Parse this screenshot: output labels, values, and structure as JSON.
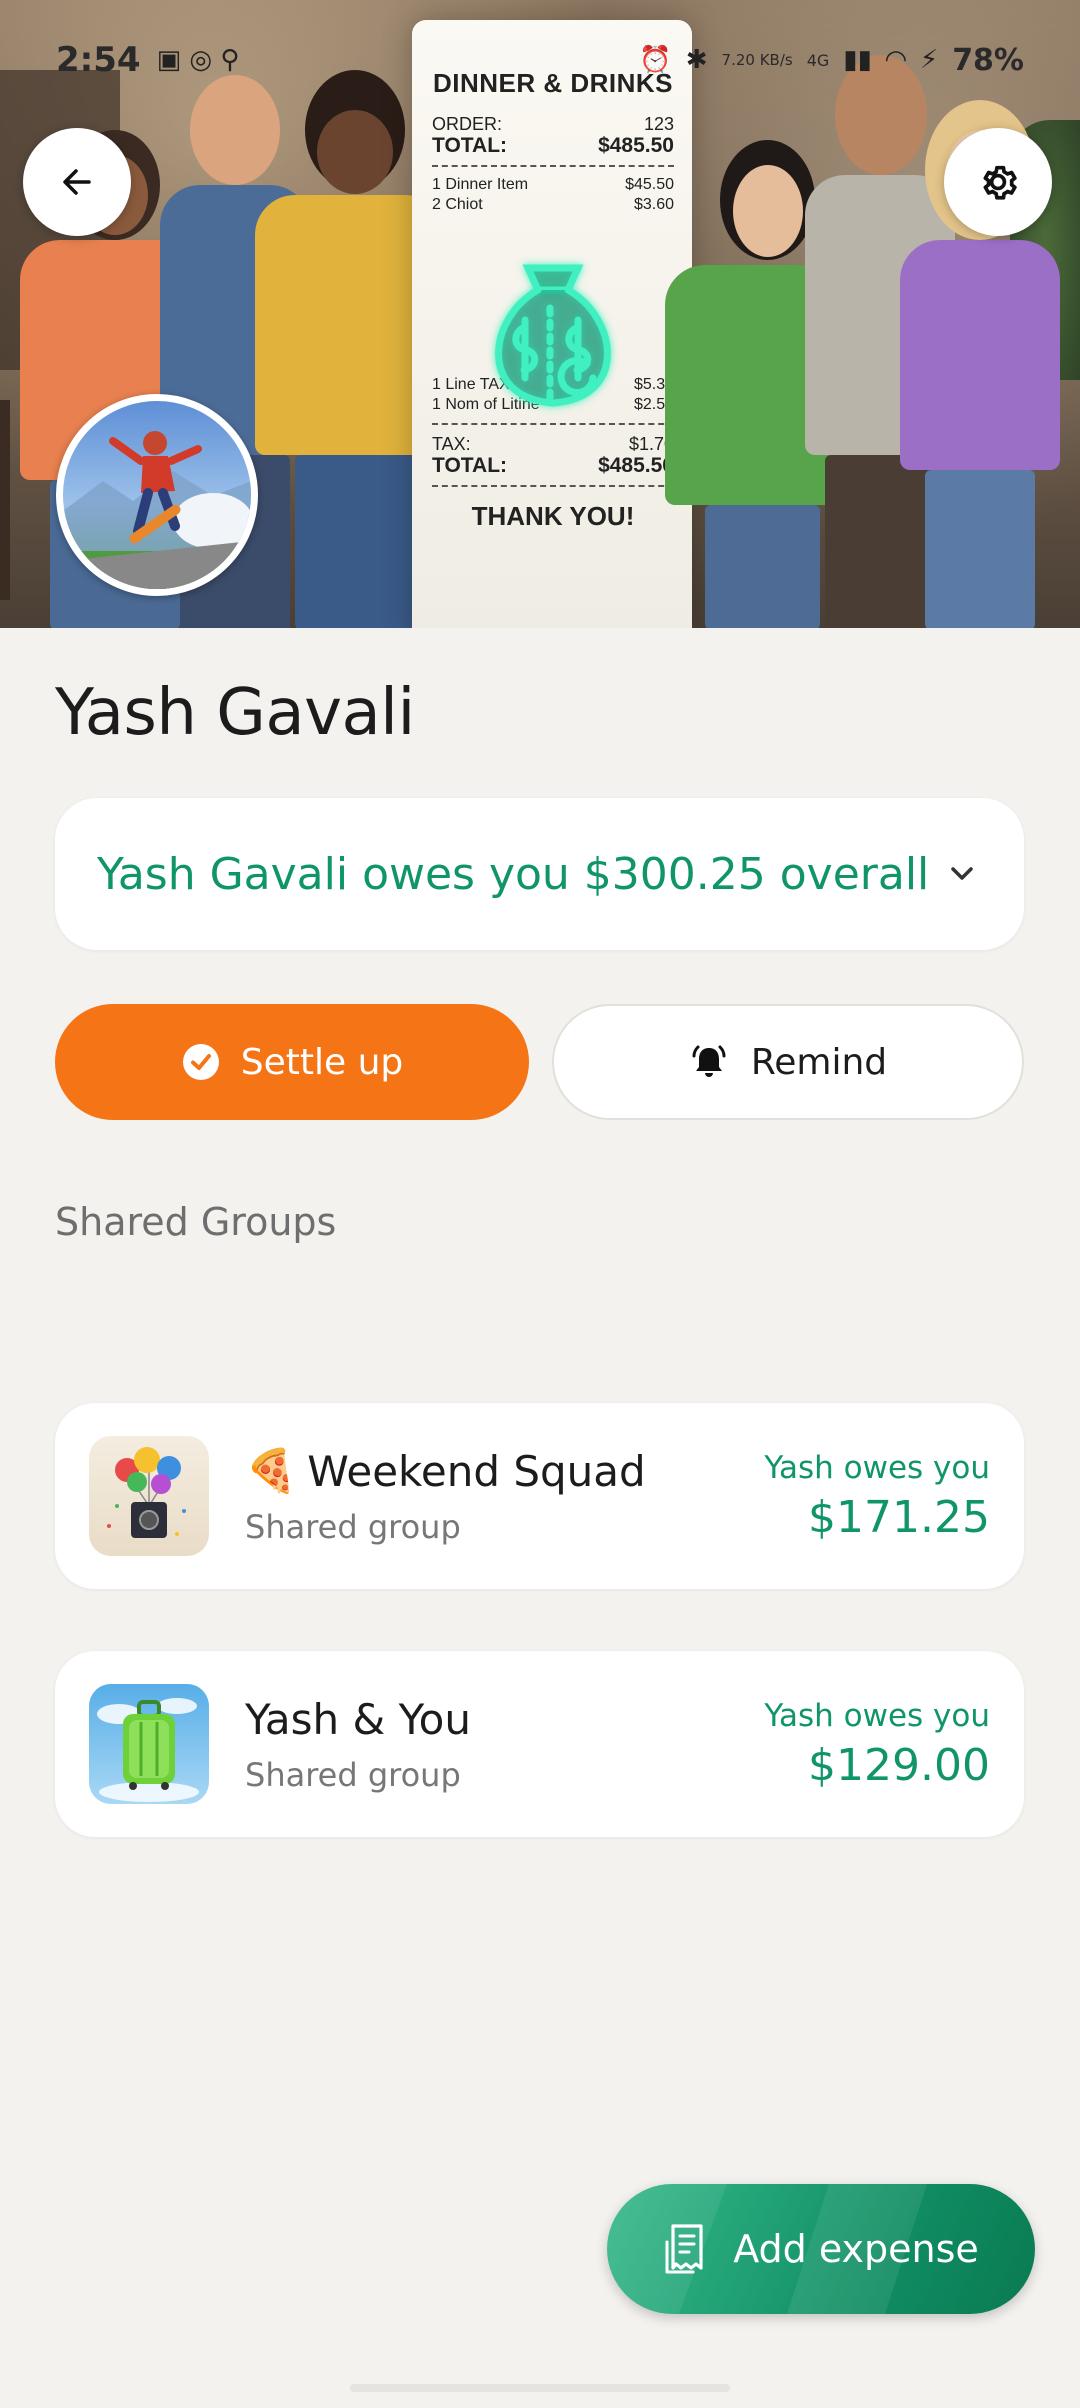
{
  "status_bar": {
    "time": "2:54",
    "battery": "78%",
    "net_speed": "7.20 KB/s",
    "net_type": "4G"
  },
  "hero": {
    "receipt": {
      "title": "DINNER & DRINKS",
      "order_label": "ORDER:",
      "order_value": "123",
      "total_label": "TOTAL:",
      "total_value": "$485.50",
      "item1_label": "1 Dinner Item",
      "item1_value": "$45.50",
      "item2_label": "2 Chiot",
      "item2_value": "$3.60",
      "item3_label": "1 Line TAX",
      "item3_value": "$5.30",
      "item4_label": "1 Nom of Litine",
      "item4_value": "$2.50",
      "tax_label": "TAX:",
      "tax_value": "$1.70",
      "total2_label": "TOTAL:",
      "total2_value": "$485.50",
      "thanks": "THANK YOU!"
    }
  },
  "profile": {
    "name": "Yash Gavali"
  },
  "balance": {
    "summary": "Yash Gavali owes you $300.25 overall"
  },
  "actions": {
    "settle_label": "Settle up",
    "remind_label": "Remind"
  },
  "shared_groups": {
    "title": "Shared Groups",
    "groups": [
      {
        "emoji": "🍕",
        "name": "Weekend Squad",
        "subtitle": "Shared group",
        "owes_label": "Yash owes you",
        "amount": "$171.25"
      },
      {
        "emoji": "",
        "name": "Yash & You",
        "subtitle": "Shared group",
        "owes_label": "Yash owes you",
        "amount": "$129.00"
      }
    ]
  },
  "fab": {
    "label": "Add expense"
  },
  "colors": {
    "accent_green": "#10956b",
    "settle_orange": "#f57416",
    "background": "#f3f2ef"
  }
}
